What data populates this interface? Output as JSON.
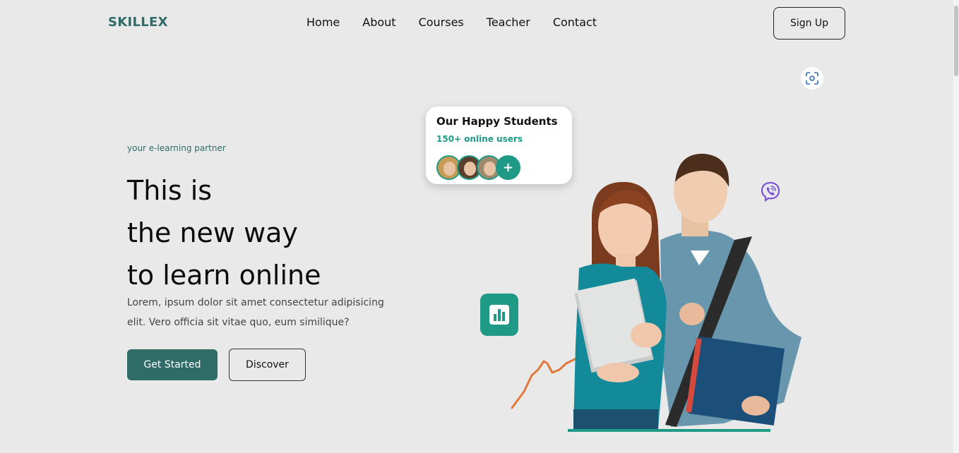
{
  "header": {
    "logo": "SKILLEX",
    "nav": [
      "Home",
      "About",
      "Courses",
      "Teacher",
      "Contact"
    ],
    "signup_label": "Sign Up"
  },
  "hero": {
    "tagline": "your e-learning partner",
    "headline": [
      "This is",
      "the new way",
      "to learn online"
    ],
    "description": "Lorem, ipsum dolor sit amet consectetur adipisicing elit. Vero officia sit vitae quo, eum similique?",
    "primary_button": "Get Started",
    "secondary_button": "Discover"
  },
  "students_card": {
    "title": "Our Happy Students",
    "subtitle": "150+ online users",
    "plus_label": "+"
  },
  "colors": {
    "background": "#e9e9e9",
    "primary": "#2f6b67",
    "accent": "#1e9a86",
    "orange_line": "#e0793b"
  },
  "icons": [
    "scan-icon",
    "viber-icon",
    "chart-icon",
    "plus-icon"
  ]
}
